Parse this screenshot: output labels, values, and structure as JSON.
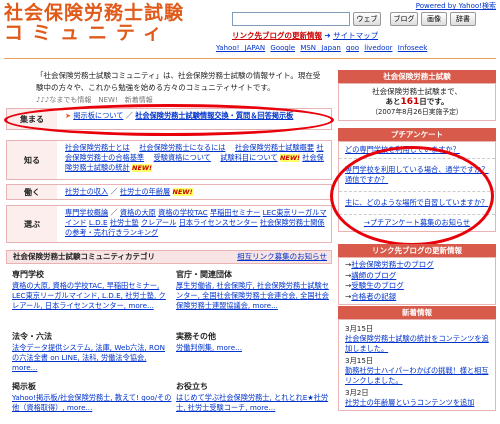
{
  "header": {
    "logo_line1": "社会保険労務士試験",
    "logo_line2": "コミュニティ",
    "powered": "Powered by Yahoo!検索",
    "search_placeholder": "",
    "btn_web": "ウェブ",
    "btn_blog": "ブログ",
    "btn_news": "画像",
    "btn_dict": "辞書",
    "link_blog_updates": "リンク先ブログの更新情報",
    "link_sitemap": "サイトマップ",
    "portal_links": [
      "Yahoo! JAPAN",
      "Google",
      "MSN Japan",
      "goo",
      "livedoor",
      "Infoseek"
    ]
  },
  "intro": {
    "text": "「社会保険労務士試験コミュニティ」は、社会保険労務士試験の情報サイト。現在受験中の方々や、これから勉強を始める方々のコミュニティサイトです。",
    "under_line": "♪♪♪なまでも情報　NEW!　新着情報"
  },
  "categories": {
    "gather": {
      "label": "集まる",
      "items": [
        "掲示板について",
        "社会保険労務士試験情報交換・質問＆回答掲示板"
      ],
      "arrows": "♪♪♪"
    },
    "know": {
      "label": "知る",
      "items": [
        "社会保険労務士とは",
        "社会保険労務士になるには",
        "社会保険労務士試験概要",
        "社会保険労務士の合格基準",
        "受験資格について",
        "試験科目について",
        "社会保険労務士試験の統計"
      ]
    },
    "work": {
      "label": "働く",
      "items": [
        "社労士の収入",
        "社労士の年齢層"
      ]
    },
    "choose": {
      "label": "選ぶ",
      "items": [
        "専門学校概論",
        "資格の大原",
        "資格の学校TAC",
        "早稲田セミナー",
        "LEC東京リーガルマインド",
        "L.D.E",
        "社労士塾",
        "クレアール",
        "日本ライセンスセンター",
        "社会保険労務士関係の参考・売れ行きランキング"
      ]
    },
    "new_badge": "NEW!"
  },
  "directory": {
    "title": "社会保険労務士試験コミュニティカテゴリ",
    "aux_link": "相互リンク募集のお知らせ",
    "sections": [
      {
        "title": "専門学校",
        "text": "資格の大原, 資格の学校TAC, 早稲田セミナー, LEC東京リーガルマインド, L.D.E, 社労士塾, クレアール, 日本ライセンスセンター, more..."
      },
      {
        "title": "官庁・関連団体",
        "text": "厚生労働省, 社会保険庁, 社会保険労務士試験センター, 全国社会保険労務士会連合会, 全国社会保険労務士連盟協議会, more..."
      },
      {
        "title": "法令・六法",
        "text": "法令データ提供システム, 法庫, Web六法, RONの六法全書 on LINE, 法科, 労働法令協会, more..."
      },
      {
        "title": "実務その他",
        "text": "労働判例集, more..."
      },
      {
        "title": "掲示板",
        "text": "Yahoo!掲示板/社会保険労務士, 教えて! goo/その他（資格取得）, more..."
      },
      {
        "title": "お役立ち",
        "text": "はじめて学ぶ社会保険労務士, とれとれE★社労士, 社労士受験コーチ, more..."
      }
    ]
  },
  "right": {
    "exam_title": "社会保険労務士試験",
    "exam_line1": "社会保険労務士試験まで、",
    "exam_prefix": "あと",
    "exam_days": "161",
    "exam_suffix": "日です。",
    "exam_note": "（2007年8月26日実施予定）",
    "survey_title": "プチアンケート",
    "survey_q1": "どの専門学校を利用していますか？",
    "survey_q2": "専門学校を利用している場合、通学ですか？通信ですか？",
    "survey_q3": "主に、どのような場所で自習していますか？",
    "survey_more": "→プチアンケート募集のお知らせ",
    "links_title": "リンク先ブログの更新情報",
    "links": [
      "社会保険労務士のブログ",
      "講師のブログ",
      "受験生のブログ",
      "合格者の記録"
    ],
    "news_title": "新着情報",
    "news": [
      {
        "date": "3月15日",
        "text": "社会保険労務士試験の統計をコンテンツを追加しました。"
      },
      {
        "date": "3月15日",
        "text": "勤務社労士ハイパーわかばの挑戦！様と相互リンクしました。"
      },
      {
        "date": "3月2日",
        "text": "社労士の年齢層というコンテンツを追加"
      }
    ]
  },
  "colors": {
    "accent": "#e05a1a",
    "oval": "#e8000a",
    "pinkHeader": "#d85a4a"
  }
}
